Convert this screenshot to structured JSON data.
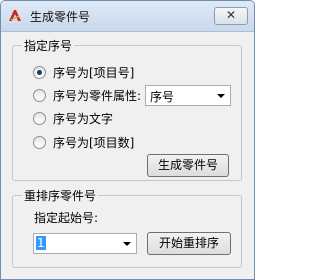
{
  "window": {
    "title": "生成零件号",
    "close_glyph": "✕"
  },
  "group_prefix": {
    "title": "指定序号",
    "options": [
      {
        "label": "序号为[项目号]",
        "checked": true
      },
      {
        "label": "序号为零件属性:",
        "checked": false
      },
      {
        "label": "序号为文字",
        "checked": false
      },
      {
        "label": "序号为[项目数]",
        "checked": false
      }
    ],
    "attribute_combo_value": "序号",
    "generate_button": "生成零件号"
  },
  "group_reorder": {
    "title": "重排序零件号",
    "start_label": "指定起始号:",
    "start_value": "1",
    "start_button": "开始重排序"
  },
  "icons": {
    "app": "app-logo-icon",
    "close": "close-icon",
    "dropdown": "chevron-down-icon"
  },
  "colors": {
    "title_bar": "#c9d9ec",
    "selection": "#3399ff",
    "radio_dot": "#1a3e6e"
  }
}
